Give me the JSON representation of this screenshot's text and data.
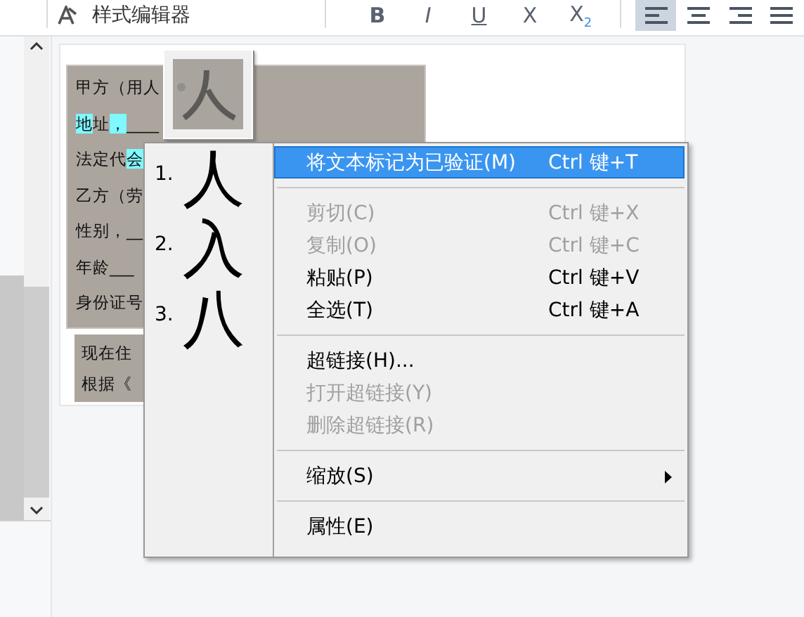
{
  "toolbar": {
    "style_editor": {
      "label": "样式编辑器"
    },
    "format_buttons": [
      {
        "label": "B",
        "kind": "bold"
      },
      {
        "label": "I",
        "kind": "italic"
      },
      {
        "label": "U",
        "kind": "underline"
      },
      {
        "label": "X",
        "kind": "plain"
      },
      {
        "label": "X$_{2}$",
        "kind": "plain"
      }
    ],
    "align_buttons": [
      {
        "kind": "left",
        "selected": true
      },
      {
        "kind": "center",
        "selected": false
      },
      {
        "kind": "right",
        "selected": false
      },
      {
        "kind": "justify",
        "selected": false
      }
    ]
  },
  "document": {
    "block_1": [
      {
        "text": "甲方（用人"
      },
      {
        "segments": [
          {
            "text": "地",
            "highlight": true
          },
          {
            "text": "址",
            "highlight": false
          },
          {
            "text": "，",
            "highlight": true
          },
          {
            "text": "____",
            "highlight": false
          }
        ]
      },
      {
        "segments": [
          {
            "text": "法定代",
            "highlight": false
          },
          {
            "text": "会",
            "highlight": true
          }
        ]
      },
      {
        "text": "乙方（劳"
      },
      {
        "text": "性别，__"
      },
      {
        "text": "年龄___"
      },
      {
        "text": "身份证号"
      }
    ],
    "block_2": [
      {
        "text": "现在住"
      },
      {
        "text": "根据《"
      }
    ]
  },
  "candidates": [
    {
      "number": "1.",
      "char": "人"
    },
    {
      "number": "2.",
      "char": "入"
    },
    {
      "number": "3.",
      "char": "八"
    }
  ],
  "context_menu": [
    {
      "kind": "item",
      "label": "将文本标记为已验证(M)",
      "shortcut": "Ctrl 键+T",
      "disabled": false,
      "selected": true
    },
    {
      "kind": "separator"
    },
    {
      "kind": "item",
      "label": "剪切(C)",
      "shortcut": "Ctrl 键+X",
      "disabled": true,
      "selected": false
    },
    {
      "kind": "item",
      "label": "复制(O)",
      "shortcut": "Ctrl 键+C",
      "disabled": true,
      "selected": false
    },
    {
      "kind": "item",
      "label": "粘贴(P)",
      "shortcut": "Ctrl 键+V",
      "disabled": false,
      "selected": false
    },
    {
      "kind": "item",
      "label": "全选(T)",
      "shortcut": "Ctrl 键+A",
      "disabled": false,
      "selected": false
    },
    {
      "kind": "separator"
    },
    {
      "kind": "item",
      "label": "超链接(H)...",
      "disabled": false,
      "selected": false
    },
    {
      "kind": "item",
      "label": "打开超链接(Y)",
      "disabled": true,
      "selected": false
    },
    {
      "kind": "item",
      "label": "删除超链接(R)",
      "disabled": true,
      "selected": false
    },
    {
      "kind": "separator"
    },
    {
      "kind": "submenu",
      "label": "缩放(S)",
      "disabled": false,
      "selected": false
    },
    {
      "kind": "separator"
    },
    {
      "kind": "item",
      "label": "属性(E)",
      "disabled": false,
      "selected": false
    }
  ]
}
